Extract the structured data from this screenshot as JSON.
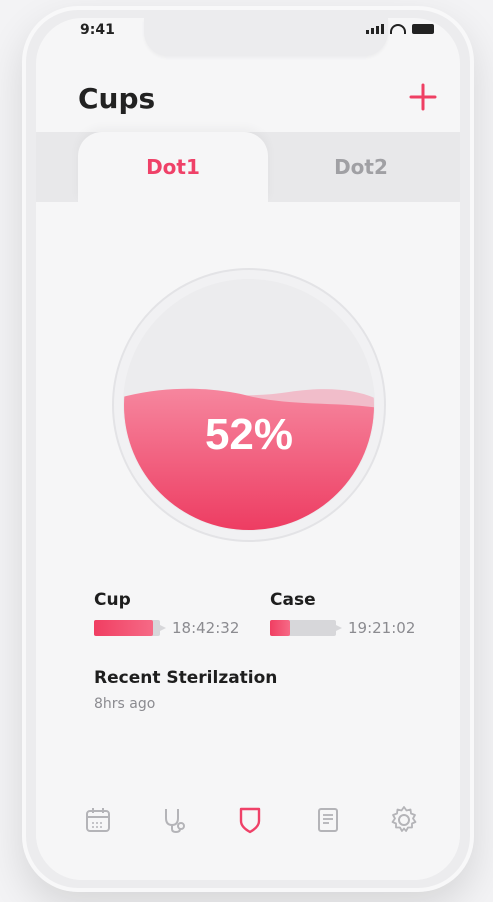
{
  "status": {
    "time": "9:41"
  },
  "header": {
    "title": "Cups",
    "add_icon": "plus-icon"
  },
  "tabs": [
    {
      "label": "Dot1",
      "active": true
    },
    {
      "label": "Dot2",
      "active": false
    }
  ],
  "gauge": {
    "percent_label": "52%",
    "fill_fraction": 0.52,
    "color": "#ef4168"
  },
  "stats": [
    {
      "label": "Cup",
      "time": "18:42:32",
      "fill_fraction": 0.9
    },
    {
      "label": "Case",
      "time": "19:21:02",
      "fill_fraction": 0.3
    }
  ],
  "recent": {
    "title": "Recent Sterilzation",
    "subtitle": "8hrs ago"
  },
  "nav": [
    {
      "icon": "calendar-icon",
      "active": false
    },
    {
      "icon": "stethoscope-icon",
      "active": false
    },
    {
      "icon": "cup-icon",
      "active": true
    },
    {
      "icon": "document-icon",
      "active": false
    },
    {
      "icon": "gear-icon",
      "active": false
    }
  ],
  "colors": {
    "accent": "#ef4168",
    "inactive_icon": "#b4b4b8"
  }
}
